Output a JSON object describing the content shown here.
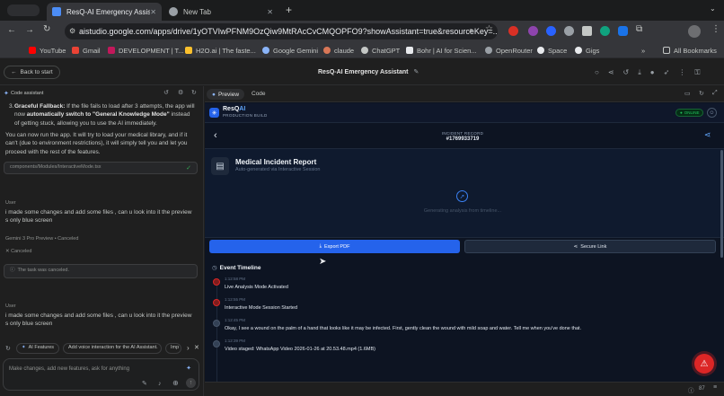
{
  "browser": {
    "tabs": [
      {
        "title": "ResQ-AI Emergency Assistant",
        "active": true
      },
      {
        "title": "New Tab",
        "active": false
      }
    ],
    "url": "aistudio.google.com/apps/drive/1yOTVIwPFNM9OzQiw9MtRAcCvCMQOPFO9?showAssistant=true&resourceKey=...",
    "bookmarks": [
      "YouTube",
      "Gmail",
      "DEVELOPMENT | T...",
      "H2O.ai | The faste...",
      "Google Gemini",
      "claude",
      "ChatGPT",
      "Bohr | AI for Scien...",
      "OpenRouter",
      "Space",
      "Gigs"
    ],
    "all_bookmarks": "All Bookmarks"
  },
  "app": {
    "back_label": "Back to start",
    "title": "ResQ-AI Emergency Assistant"
  },
  "chat": {
    "header": "Code assistant",
    "fallback_num": "3.",
    "fallback_bold": "Graceful Fallback:",
    "fallback_t1": " If the file fails to load after 3 attempts, the app will now ",
    "fallback_bold2": "automatically switch to \"General Knowledge Mode\"",
    "fallback_t2": " instead of getting stuck, allowing you to use the AI immediately.",
    "run_text": "You can now run the app. It will try to load your medical library, and if it can't (due to environment restrictions), it will simply tell you and let you proceed with the rest of the features.",
    "file_pill": "components/Modules/InteractiveMode.tsx",
    "user_label": "User",
    "user_msg": "i made some changes and add some files , can u look into it the preview s only blue screen",
    "model_label": "Gemini 3 Pro Preview",
    "model_state": "Canceled",
    "canceled": "Canceled",
    "task_canceled": "The task was canceled.",
    "user_label2": "User",
    "user_msg2": "i made some changes and add some files , can u look into it the preview s only blue screen",
    "chips": [
      "AI Features",
      "Add voice interaction for the AI Assistant.",
      "Imp"
    ],
    "input_placeholder": "Make changes, add new features, ask for anything"
  },
  "preview": {
    "tabs": [
      "Preview",
      "Code"
    ],
    "brand": "ResQ",
    "brand_ai": "AI",
    "brand_sub": "PRODUCTION BUILD",
    "online": "ONLINE",
    "incident_label": "INCIDENT RECORD",
    "incident_id": "#1769933719",
    "report_title": "Medical Incident Report",
    "report_sub": "Auto-generated via Interactive Session",
    "generating": "Generating analysis from timeline...",
    "export_label": "Export PDF",
    "secure_label": "Secure Link",
    "timeline_title": "Event Timeline",
    "events": [
      {
        "time": "1:12:58 PM",
        "text": "Live Analysis Mode Activated",
        "kind": "red"
      },
      {
        "time": "1:12:55 PM",
        "text": "Interactive Mode Session Started",
        "kind": "red"
      },
      {
        "time": "1:12:45 PM",
        "text": "Okay, I see a wound on the palm of a hand that looks like it may be infected. First, gently clean the wound with mild soap and water. Tell me when you've done that.",
        "kind": "gray"
      },
      {
        "time": "1:12:39 PM",
        "text": "Video staged: WhatsApp Video 2026-01-26 at 20.53.48.mp4 (1.6MB)",
        "kind": "gray"
      }
    ],
    "zoom": "87"
  },
  "colors": {
    "accent": "#2563eb",
    "online": "#22c55e",
    "danger": "#dc2626"
  }
}
